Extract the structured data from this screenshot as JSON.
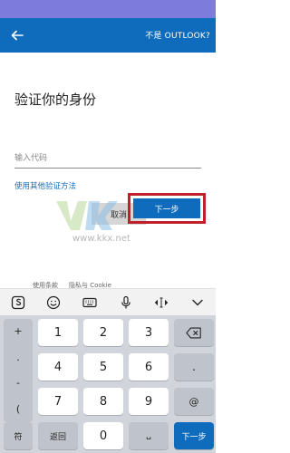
{
  "header": {
    "not_outlook_label": "不是 OUTLOOK?"
  },
  "main": {
    "title": "验证你的身份",
    "code_placeholder": "输入代码",
    "other_method_link": "使用其他验证方法",
    "cancel_label": "取消",
    "next_label": "下一步"
  },
  "watermark": {
    "text": "www.kkx.net"
  },
  "footer": {
    "terms_link": "使用条款",
    "privacy_link": "隐私与 Cookie"
  },
  "keyboard": {
    "toolbar_icons": [
      "sogou-logo-icon",
      "emoji-icon",
      "keyboard-icon",
      "microphone-icon",
      "cursor-move-icon",
      "collapse-icon"
    ],
    "side_keys": [
      "+",
      ".",
      "-",
      "("
    ],
    "digits": [
      "1",
      "2",
      "3",
      "4",
      "5",
      "6",
      "7",
      "8",
      "9",
      "0"
    ],
    "right_keys": [
      ".",
      "@"
    ],
    "backspace_icon": "backspace-icon",
    "symbol_key": "符",
    "back_key": "返回",
    "space_key": "␣",
    "next_key": "下一步"
  },
  "colors": {
    "accent": "#0f6cbd",
    "highlight": "#c0202a",
    "status_strip": "#7d7bdc"
  }
}
